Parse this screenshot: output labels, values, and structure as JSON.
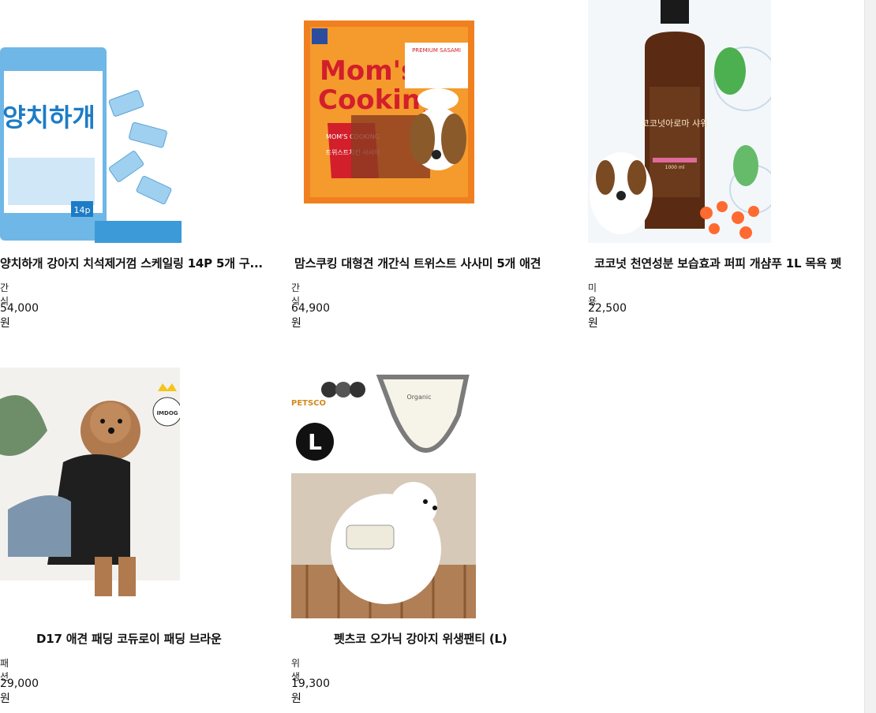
{
  "products": [
    {
      "title": "양치하개 강아지 치석제거껌 스케일링 14P 5개 구...",
      "category": "간식",
      "price": "54,000원",
      "image_text": {
        "brand": "양치하개",
        "count": "14p"
      }
    },
    {
      "title": "맘스쿠킹 대형견 개간식 트위스트 사사미 5개 애견",
      "category": "간식",
      "price": "64,900원",
      "image_text": {
        "brand": "Mom's Cooking",
        "badge": "MOM'S COOKING",
        "sub": "트위스트치킨 사사미",
        "tag": "PREMIUM SASAMI"
      }
    },
    {
      "title": "코코넛 천연성분 보습효과 퍼피 개샴푸 1L 목욕 펫",
      "category": "미용",
      "price": "22,500원",
      "image_text": {
        "label": "코코넛아로마 샤워",
        "volume": "1000 ml"
      }
    },
    {
      "title": "D17 애견 패딩 코듀로이 패딩 브라운",
      "category": "패션",
      "price": "29,000원",
      "image_text": {
        "logo": "IMDOG"
      }
    },
    {
      "title": "펫츠코 오가닉 강아지 위생팬티 (L)",
      "category": "위생",
      "price": "19,300원",
      "image_text": {
        "brand": "PETSCO",
        "size": "L",
        "tag": "Organic"
      }
    }
  ]
}
